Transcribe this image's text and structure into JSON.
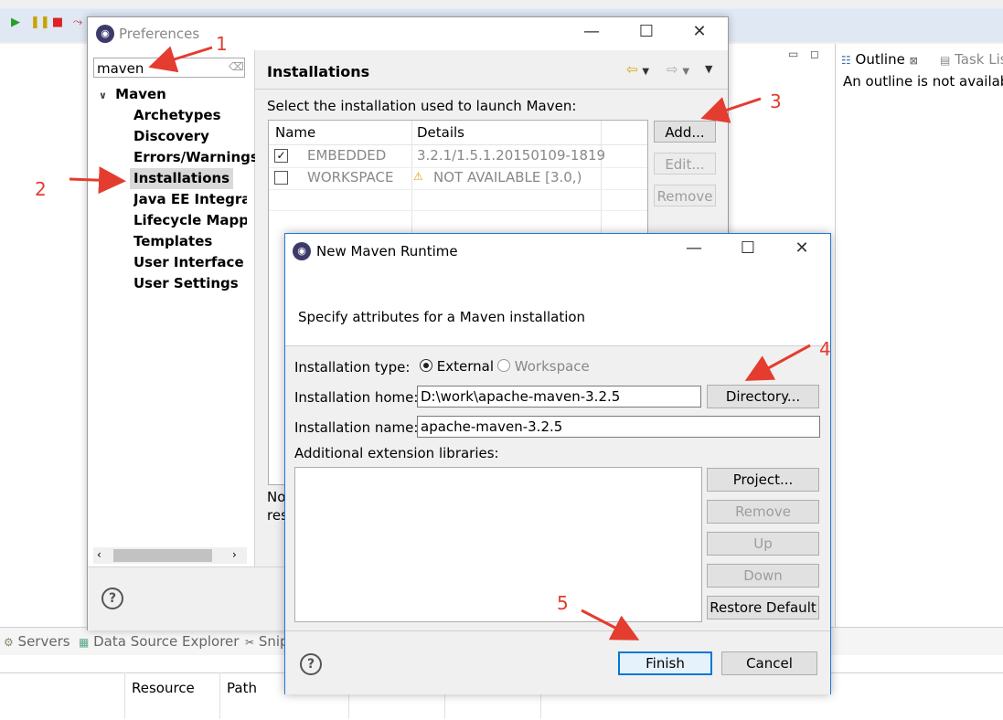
{
  "ide": {
    "outline_tab": "Outline",
    "task_tab": "Task Lis",
    "outline_message": "An outline is not availabl",
    "bottom_tabs": [
      "Servers",
      "Data Source Explorer",
      "Snip"
    ],
    "table_headers": [
      "Resource",
      "Path"
    ]
  },
  "preferences": {
    "title": "Preferences",
    "filter_value": "maven",
    "tree": {
      "root": "Maven",
      "children": [
        "Archetypes",
        "Discovery",
        "Errors/Warnings",
        "Installations",
        "Java EE Integrati",
        "Lifecycle Mappin",
        "Templates",
        "User Interface",
        "User Settings"
      ]
    },
    "page_title": "Installations",
    "instruction": "Select the installation used to launch Maven:",
    "columns": [
      "Name",
      "Details"
    ],
    "rows": [
      {
        "name": "EMBEDDED",
        "details": "3.2.1/1.5.1.20150109-1819",
        "checked": true,
        "warning": false
      },
      {
        "name": "WORKSPACE",
        "details": "NOT AVAILABLE [3.0,)",
        "checked": false,
        "warning": true
      }
    ],
    "buttons": {
      "add": "Add...",
      "edit": "Edit...",
      "remove": "Remove"
    },
    "note_partial": [
      "No",
      "res"
    ]
  },
  "dialog": {
    "title": "New Maven Runtime",
    "header_text": "Specify attributes for a Maven installation",
    "type_label": "Installation type:",
    "type_options": [
      "External",
      "Workspace"
    ],
    "type_selected": "External",
    "home_label": "Installation home:",
    "home_value": "D:\\work\\apache-maven-3.2.5",
    "directory_button": "Directory...",
    "name_label": "Installation name:",
    "name_value": "apache-maven-3.2.5",
    "ext_label": "Additional extension libraries:",
    "ext_buttons": {
      "project": "Project...",
      "remove": "Remove",
      "up": "Up",
      "down": "Down",
      "restore": "Restore Default"
    },
    "finish": "Finish",
    "cancel": "Cancel"
  },
  "annotations": [
    "1",
    "2",
    "3",
    "4",
    "5"
  ],
  "colors": {
    "annotation": "#e43c2f",
    "accent": "#1e7ad6"
  }
}
